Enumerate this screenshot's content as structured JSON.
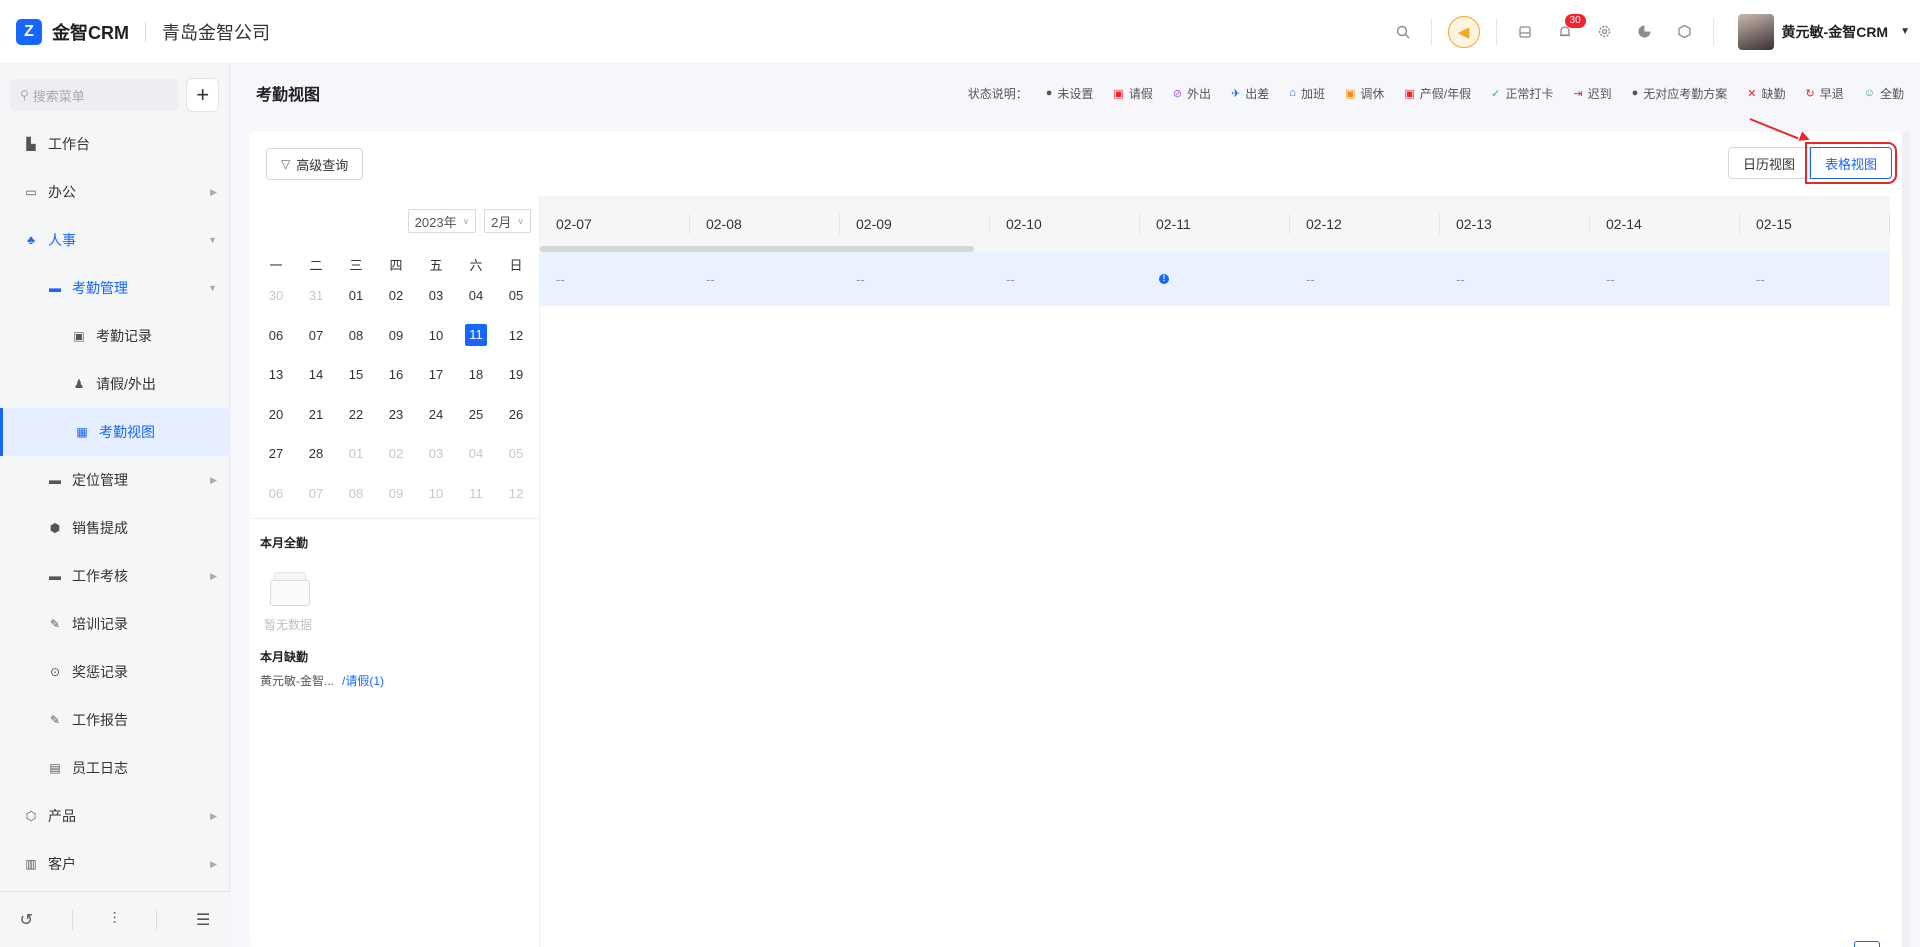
{
  "brand": {
    "logo_glyph": "Z",
    "name": "金智CRM",
    "company": "青岛金智公司"
  },
  "header": {
    "notification_count": "30",
    "user_name": "黄元敏-金智CRM",
    "icons": [
      "search-icon",
      "speaker-icon",
      "inbox-icon",
      "bell-icon",
      "gear-icon",
      "pie-chart-icon",
      "cube-icon"
    ]
  },
  "sidebar": {
    "search_placeholder": "搜索菜单",
    "add_label": "+",
    "items": [
      {
        "label": "工作台"
      },
      {
        "label": "办公"
      },
      {
        "label": "人事"
      },
      {
        "label": "考勤管理"
      },
      {
        "label": "考勤记录"
      },
      {
        "label": "请假/外出"
      },
      {
        "label": "考勤视图"
      },
      {
        "label": "定位管理"
      },
      {
        "label": "销售提成"
      },
      {
        "label": "工作考核"
      },
      {
        "label": "培训记录"
      },
      {
        "label": "奖惩记录"
      },
      {
        "label": "工作报告"
      },
      {
        "label": "员工日志"
      },
      {
        "label": "产品"
      },
      {
        "label": "客户"
      }
    ]
  },
  "page": {
    "title": "考勤视图",
    "legend_label": "状态说明：",
    "legend": [
      {
        "label": "未设置",
        "glyph": "●",
        "color": "#555555"
      },
      {
        "label": "请假",
        "glyph": "▣",
        "color": "#f5222d"
      },
      {
        "label": "外出",
        "glyph": "⊘",
        "color": "#a15cf0"
      },
      {
        "label": "出差",
        "glyph": "✈",
        "color": "#1767ff"
      },
      {
        "label": "加班",
        "glyph": "⌂",
        "color": "#1767ff"
      },
      {
        "label": "调休",
        "glyph": "▣",
        "color": "#fa8c16"
      },
      {
        "label": "产假/年假",
        "glyph": "▣",
        "color": "#f5222d"
      },
      {
        "label": "正常打卡",
        "glyph": "✓",
        "color": "#2db36a"
      },
      {
        "label": "迟到",
        "glyph": "⇥",
        "color": "#f5222d"
      },
      {
        "label": "无对应考勤方案",
        "glyph": "●",
        "color": "#555555"
      },
      {
        "label": "缺勤",
        "glyph": "✕",
        "color": "#f5222d"
      },
      {
        "label": "早退",
        "glyph": "↻",
        "color": "#f5222d"
      },
      {
        "label": "全勤",
        "glyph": "☺",
        "color": "#2db36a"
      }
    ],
    "advanced_query": "高级查询",
    "calendar_view": "日历视图",
    "table_view": "表格视图"
  },
  "calendar": {
    "year": "2023年",
    "month": "2月",
    "weekdays": [
      "一",
      "二",
      "三",
      "四",
      "五",
      "六",
      "日"
    ],
    "weeks": [
      [
        {
          "d": "30",
          "o": true
        },
        {
          "d": "31",
          "o": true
        },
        {
          "d": "01"
        },
        {
          "d": "02"
        },
        {
          "d": "03"
        },
        {
          "d": "04"
        },
        {
          "d": "05"
        }
      ],
      [
        {
          "d": "06"
        },
        {
          "d": "07"
        },
        {
          "d": "08"
        },
        {
          "d": "09"
        },
        {
          "d": "10"
        },
        {
          "d": "11",
          "t": true
        },
        {
          "d": "12"
        }
      ],
      [
        {
          "d": "13"
        },
        {
          "d": "14"
        },
        {
          "d": "15"
        },
        {
          "d": "16"
        },
        {
          "d": "17"
        },
        {
          "d": "18"
        },
        {
          "d": "19"
        }
      ],
      [
        {
          "d": "20"
        },
        {
          "d": "21"
        },
        {
          "d": "22"
        },
        {
          "d": "23"
        },
        {
          "d": "24"
        },
        {
          "d": "25"
        },
        {
          "d": "26"
        }
      ],
      [
        {
          "d": "27"
        },
        {
          "d": "28"
        },
        {
          "d": "01",
          "o": true
        },
        {
          "d": "02",
          "o": true
        },
        {
          "d": "03",
          "o": true
        },
        {
          "d": "04",
          "o": true
        },
        {
          "d": "05",
          "o": true
        }
      ],
      [
        {
          "d": "06",
          "o": true
        },
        {
          "d": "07",
          "o": true
        },
        {
          "d": "08",
          "o": true
        },
        {
          "d": "09",
          "o": true
        },
        {
          "d": "10",
          "o": true
        },
        {
          "d": "11",
          "o": true
        },
        {
          "d": "12",
          "o": true
        }
      ]
    ],
    "full_attendance_title": "本月全勤",
    "empty_text": "暂无数据",
    "absence_title": "本月缺勤",
    "absence_name": "黄元敏-金智...",
    "absence_link": "/请假(1)"
  },
  "grid": {
    "dates": [
      "02-07",
      "02-08",
      "02-09",
      "02-10",
      "02-11",
      "02-12",
      "02-13",
      "02-14",
      "02-15"
    ],
    "values": [
      "--",
      "--",
      "--",
      "--",
      "!",
      "--",
      "--",
      "--",
      "--"
    ]
  }
}
